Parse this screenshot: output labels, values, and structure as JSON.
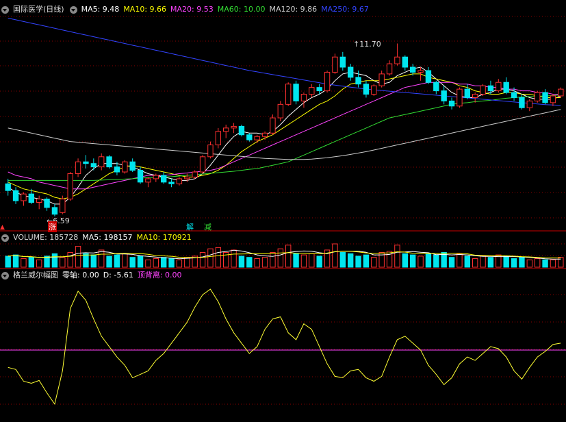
{
  "main_legend": {
    "title": "国际医学(日线)",
    "items": [
      {
        "label": "MA5: 9.48",
        "color": "#ffffff"
      },
      {
        "label": "MA10: 9.66",
        "color": "#ffff00"
      },
      {
        "label": "MA20: 9.53",
        "color": "#ff44ff"
      },
      {
        "label": "MA60: 10.00",
        "color": "#33dd33"
      },
      {
        "label": "MA120: 9.86",
        "color": "#cccccc"
      },
      {
        "label": "MA250: 9.67",
        "color": "#3344ff"
      }
    ]
  },
  "vol_legend": {
    "title": "VOLUME: 185728",
    "items": [
      {
        "label": "MA5: 198157",
        "color": "#ffffff"
      },
      {
        "label": "MA10: 170921",
        "color": "#ffff00"
      }
    ]
  },
  "ind_legend": {
    "title": "格兰威尔幅图",
    "items": [
      {
        "label": "零轴: 0.00",
        "color": "#ffffff"
      },
      {
        "label": "D: -5.61",
        "color": "#ffffff"
      },
      {
        "label": "顶背离: 0.00",
        "color": "#ff44ff"
      }
    ]
  },
  "annotations": {
    "high": "11.70",
    "low": "6.59",
    "mark_zhang": "涨",
    "mark_jie": "解",
    "mark_jian": "减"
  },
  "colors": {
    "up": "#ff3030",
    "down": "#00e5ee",
    "grid": "#8b0000",
    "bg": "#000000"
  },
  "chart_data": {
    "type": "candlestick",
    "price_range": [
      6.3,
      12.5
    ],
    "candles": [
      [
        7.55,
        7.7,
        7.2,
        7.35
      ],
      [
        7.35,
        7.45,
        6.95,
        7.05
      ],
      [
        7.05,
        7.3,
        6.9,
        7.25
      ],
      [
        7.25,
        7.4,
        6.95,
        7.0
      ],
      [
        7.0,
        7.2,
        6.8,
        7.1
      ],
      [
        7.1,
        7.15,
        6.75,
        6.85
      ],
      [
        6.85,
        6.95,
        6.59,
        6.65
      ],
      [
        6.7,
        7.2,
        6.65,
        7.1
      ],
      [
        7.1,
        7.9,
        7.05,
        7.85
      ],
      [
        7.85,
        8.3,
        7.75,
        8.2
      ],
      [
        8.2,
        8.4,
        8.0,
        8.15
      ],
      [
        8.15,
        8.3,
        7.95,
        8.05
      ],
      [
        8.05,
        8.45,
        7.95,
        8.35
      ],
      [
        8.35,
        8.4,
        8.0,
        8.05
      ],
      [
        8.05,
        8.2,
        7.8,
        7.9
      ],
      [
        7.9,
        8.25,
        7.85,
        8.2
      ],
      [
        8.2,
        8.3,
        7.9,
        7.95
      ],
      [
        7.95,
        8.05,
        7.55,
        7.6
      ],
      [
        7.6,
        7.75,
        7.45,
        7.7
      ],
      [
        7.7,
        7.85,
        7.6,
        7.8
      ],
      [
        7.8,
        7.9,
        7.55,
        7.6
      ],
      [
        7.6,
        7.7,
        7.45,
        7.55
      ],
      [
        7.55,
        7.75,
        7.5,
        7.7
      ],
      [
        7.7,
        7.85,
        7.6,
        7.75
      ],
      [
        7.75,
        7.95,
        7.7,
        7.9
      ],
      [
        7.9,
        8.4,
        7.85,
        8.35
      ],
      [
        8.35,
        8.8,
        8.3,
        8.7
      ],
      [
        8.7,
        9.2,
        8.6,
        9.1
      ],
      [
        9.1,
        9.3,
        8.9,
        9.2
      ],
      [
        9.2,
        9.35,
        9.05,
        9.25
      ],
      [
        9.25,
        9.3,
        8.95,
        9.0
      ],
      [
        9.0,
        9.05,
        8.8,
        8.85
      ],
      [
        8.85,
        9.0,
        8.75,
        8.95
      ],
      [
        8.95,
        9.1,
        8.85,
        9.05
      ],
      [
        9.05,
        9.6,
        9.0,
        9.5
      ],
      [
        9.5,
        10.0,
        9.4,
        9.9
      ],
      [
        9.9,
        10.55,
        9.85,
        10.5
      ],
      [
        10.5,
        10.6,
        9.9,
        10.0
      ],
      [
        10.0,
        10.25,
        9.8,
        10.2
      ],
      [
        10.2,
        10.5,
        10.1,
        10.4
      ],
      [
        10.4,
        10.5,
        10.2,
        10.3
      ],
      [
        10.3,
        10.9,
        10.25,
        10.85
      ],
      [
        10.85,
        11.4,
        10.8,
        11.3
      ],
      [
        11.3,
        11.45,
        10.9,
        11.0
      ],
      [
        11.0,
        11.1,
        10.6,
        10.7
      ],
      [
        10.7,
        10.9,
        10.4,
        10.5
      ],
      [
        10.5,
        10.6,
        10.1,
        10.2
      ],
      [
        10.2,
        10.5,
        10.15,
        10.45
      ],
      [
        10.45,
        10.9,
        10.4,
        10.8
      ],
      [
        10.8,
        11.2,
        10.75,
        11.1
      ],
      [
        11.1,
        11.7,
        11.05,
        11.3
      ],
      [
        11.3,
        11.35,
        10.9,
        11.0
      ],
      [
        11.0,
        11.1,
        10.75,
        10.85
      ],
      [
        10.85,
        11.0,
        10.6,
        10.9
      ],
      [
        10.9,
        11.0,
        10.5,
        10.55
      ],
      [
        10.55,
        10.6,
        10.2,
        10.3
      ],
      [
        10.3,
        10.45,
        9.9,
        10.0
      ],
      [
        10.0,
        10.1,
        9.75,
        9.85
      ],
      [
        9.85,
        10.4,
        9.8,
        10.35
      ],
      [
        10.35,
        10.5,
        10.05,
        10.1
      ],
      [
        10.1,
        10.25,
        9.95,
        10.2
      ],
      [
        10.2,
        10.5,
        10.15,
        10.45
      ],
      [
        10.45,
        10.6,
        10.2,
        10.3
      ],
      [
        10.3,
        10.65,
        10.25,
        10.55
      ],
      [
        10.55,
        10.7,
        10.2,
        10.25
      ],
      [
        10.25,
        10.4,
        10.0,
        10.1
      ],
      [
        10.1,
        10.2,
        9.75,
        9.8
      ],
      [
        9.8,
        10.05,
        9.7,
        10.0
      ],
      [
        10.0,
        10.3,
        9.95,
        10.25
      ],
      [
        10.25,
        10.35,
        9.9,
        9.95
      ],
      [
        9.95,
        10.2,
        9.85,
        10.15
      ],
      [
        10.15,
        10.4,
        10.1,
        10.35
      ]
    ],
    "volumes": [
      0.45,
      0.5,
      0.35,
      0.4,
      0.3,
      0.45,
      0.55,
      0.4,
      0.6,
      0.85,
      0.55,
      0.5,
      0.7,
      0.45,
      0.5,
      0.55,
      0.4,
      0.45,
      0.3,
      0.35,
      0.4,
      0.35,
      0.3,
      0.4,
      0.45,
      0.6,
      0.75,
      0.8,
      0.6,
      0.7,
      0.45,
      0.4,
      0.35,
      0.4,
      0.6,
      0.75,
      0.9,
      0.55,
      0.5,
      0.55,
      0.45,
      0.7,
      0.95,
      0.6,
      0.55,
      0.45,
      0.5,
      0.4,
      0.6,
      0.65,
      0.9,
      0.55,
      0.5,
      0.45,
      0.55,
      0.5,
      0.6,
      0.4,
      0.55,
      0.45,
      0.35,
      0.45,
      0.4,
      0.5,
      0.45,
      0.35,
      0.4,
      0.3,
      0.35,
      0.3,
      0.3,
      0.4
    ],
    "indicator": [
      -25,
      -28,
      -45,
      -48,
      -44,
      -62,
      -78,
      -30,
      60,
      85,
      72,
      45,
      20,
      5,
      -10,
      -22,
      -40,
      -35,
      -30,
      -15,
      -5,
      10,
      25,
      40,
      62,
      80,
      88,
      70,
      45,
      25,
      10,
      -5,
      5,
      30,
      45,
      48,
      25,
      15,
      38,
      30,
      5,
      -20,
      -38,
      -40,
      -30,
      -28,
      -40,
      -45,
      -38,
      -10,
      15,
      20,
      10,
      0,
      -22,
      -35,
      -50,
      -40,
      -20,
      -10,
      -15,
      -5,
      5,
      2,
      -10,
      -30,
      -42,
      -25,
      -10,
      -2,
      8,
      10
    ],
    "indicator_range": [
      -100,
      100
    ],
    "series": [
      {
        "name": "MA5",
        "values": [
          7.45,
          7.3,
          7.2,
          7.15,
          7.1,
          7.05,
          6.95,
          6.95,
          7.15,
          7.45,
          7.8,
          8.0,
          8.15,
          8.15,
          8.15,
          8.1,
          8.05,
          7.95,
          7.85,
          7.8,
          7.75,
          7.7,
          7.65,
          7.65,
          7.7,
          7.85,
          8.1,
          8.4,
          8.7,
          8.95,
          9.1,
          9.05,
          9.05,
          9.0,
          9.1,
          9.3,
          9.55,
          9.75,
          9.95,
          10.1,
          10.2,
          10.35,
          10.6,
          10.8,
          10.85,
          10.8,
          10.75,
          10.6,
          10.5,
          10.55,
          10.75,
          10.85,
          10.95,
          11.0,
          10.85,
          10.65,
          10.45,
          10.25,
          10.15,
          10.1,
          10.1,
          10.2,
          10.25,
          10.35,
          10.35,
          10.3,
          10.2,
          10.1,
          10.05,
          10.05,
          10.05,
          10.15
        ]
      },
      {
        "name": "MA10",
        "values": [
          7.6,
          7.5,
          7.4,
          7.35,
          7.3,
          7.25,
          7.15,
          7.1,
          7.15,
          7.25,
          7.4,
          7.55,
          7.7,
          7.85,
          7.95,
          8.05,
          8.1,
          8.05,
          8.0,
          7.95,
          7.9,
          7.85,
          7.8,
          7.75,
          7.75,
          7.8,
          7.85,
          7.95,
          8.1,
          8.3,
          8.5,
          8.65,
          8.8,
          8.9,
          9.0,
          9.15,
          9.3,
          9.45,
          9.6,
          9.75,
          9.9,
          10.0,
          10.15,
          10.35,
          10.5,
          10.55,
          10.6,
          10.6,
          10.6,
          10.65,
          10.7,
          10.75,
          10.8,
          10.8,
          10.7,
          10.65,
          10.6,
          10.55,
          10.45,
          10.4,
          10.3,
          10.25,
          10.2,
          10.2,
          10.25,
          10.25,
          10.2,
          10.2,
          10.15,
          10.1,
          10.1,
          10.1
        ]
      },
      {
        "name": "MA20",
        "values": [
          7.9,
          7.8,
          7.75,
          7.7,
          7.6,
          7.55,
          7.5,
          7.45,
          7.4,
          7.4,
          7.4,
          7.45,
          7.5,
          7.55,
          7.6,
          7.65,
          7.7,
          7.75,
          7.8,
          7.8,
          7.8,
          7.82,
          7.85,
          7.87,
          7.9,
          7.92,
          7.95,
          8.0,
          8.1,
          8.2,
          8.3,
          8.4,
          8.5,
          8.6,
          8.7,
          8.8,
          8.9,
          9.0,
          9.1,
          9.2,
          9.3,
          9.4,
          9.5,
          9.6,
          9.7,
          9.8,
          9.9,
          10.0,
          10.1,
          10.2,
          10.3,
          10.4,
          10.45,
          10.5,
          10.55,
          10.55,
          10.55,
          10.55,
          10.5,
          10.5,
          10.45,
          10.45,
          10.4,
          10.4,
          10.35,
          10.35,
          10.3,
          10.3,
          10.25,
          10.25,
          10.2,
          10.2
        ]
      },
      {
        "name": "MA60",
        "values": [
          7.65,
          7.65,
          7.65,
          7.65,
          7.65,
          7.65,
          7.65,
          7.65,
          7.65,
          7.65,
          7.65,
          7.65,
          7.66,
          7.67,
          7.68,
          7.69,
          7.7,
          7.72,
          7.73,
          7.74,
          7.75,
          7.76,
          7.78,
          7.8,
          7.82,
          7.84,
          7.86,
          7.88,
          7.9,
          7.92,
          7.95,
          7.98,
          8.0,
          8.05,
          8.1,
          8.15,
          8.2,
          8.3,
          8.4,
          8.5,
          8.6,
          8.7,
          8.8,
          8.9,
          9.0,
          9.1,
          9.2,
          9.3,
          9.4,
          9.5,
          9.55,
          9.6,
          9.65,
          9.7,
          9.75,
          9.8,
          9.85,
          9.9,
          9.93,
          9.95,
          9.98,
          10.0,
          10.02,
          10.05,
          10.08,
          10.1,
          10.12,
          10.13,
          10.14,
          10.15,
          10.16,
          10.18
        ]
      },
      {
        "name": "MA120",
        "values": [
          9.2,
          9.15,
          9.1,
          9.05,
          9.0,
          8.95,
          8.9,
          8.85,
          8.8,
          8.78,
          8.76,
          8.74,
          8.72,
          8.7,
          8.68,
          8.66,
          8.64,
          8.62,
          8.6,
          8.58,
          8.56,
          8.54,
          8.52,
          8.5,
          8.48,
          8.46,
          8.44,
          8.42,
          8.4,
          8.38,
          8.36,
          8.34,
          8.32,
          8.3,
          8.29,
          8.28,
          8.27,
          8.27,
          8.27,
          8.28,
          8.3,
          8.32,
          8.35,
          8.38,
          8.42,
          8.46,
          8.5,
          8.55,
          8.6,
          8.65,
          8.7,
          8.75,
          8.8,
          8.85,
          8.9,
          8.95,
          9.0,
          9.05,
          9.1,
          9.15,
          9.2,
          9.25,
          9.3,
          9.35,
          9.4,
          9.45,
          9.5,
          9.55,
          9.6,
          9.65,
          9.7,
          9.75
        ]
      },
      {
        "name": "MA250",
        "values": [
          12.45,
          12.4,
          12.35,
          12.3,
          12.25,
          12.2,
          12.15,
          12.1,
          12.05,
          12.0,
          11.95,
          11.9,
          11.85,
          11.8,
          11.75,
          11.7,
          11.65,
          11.6,
          11.55,
          11.5,
          11.45,
          11.4,
          11.35,
          11.3,
          11.25,
          11.2,
          11.15,
          11.1,
          11.05,
          11.0,
          10.95,
          10.9,
          10.86,
          10.82,
          10.78,
          10.74,
          10.7,
          10.66,
          10.62,
          10.58,
          10.54,
          10.5,
          10.47,
          10.44,
          10.41,
          10.38,
          10.35,
          10.33,
          10.31,
          10.29,
          10.27,
          10.25,
          10.23,
          10.21,
          10.19,
          10.17,
          10.15,
          10.13,
          10.11,
          10.09,
          10.07,
          10.05,
          10.03,
          10.01,
          9.99,
          9.97,
          9.95,
          9.93,
          9.91,
          9.89,
          9.88,
          9.87
        ]
      }
    ]
  }
}
